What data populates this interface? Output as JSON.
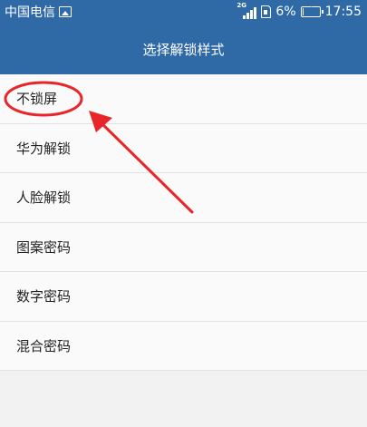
{
  "status_bar": {
    "carrier": "中国电信",
    "network": "2G",
    "battery_percent": "6%",
    "battery_level": 0.06,
    "time": "17:55"
  },
  "header": {
    "title": "选择解锁样式"
  },
  "options": [
    {
      "label": "不锁屏"
    },
    {
      "label": "华为解锁"
    },
    {
      "label": "人脸解锁"
    },
    {
      "label": "图案密码"
    },
    {
      "label": "数字密码"
    },
    {
      "label": "混合密码"
    }
  ],
  "annotation": {
    "color": "#e8262a",
    "target": "不锁屏"
  },
  "colors": {
    "header_bg": "#2f6aa7",
    "list_bg": "#fafafa",
    "page_bg": "#f2f2f2"
  }
}
